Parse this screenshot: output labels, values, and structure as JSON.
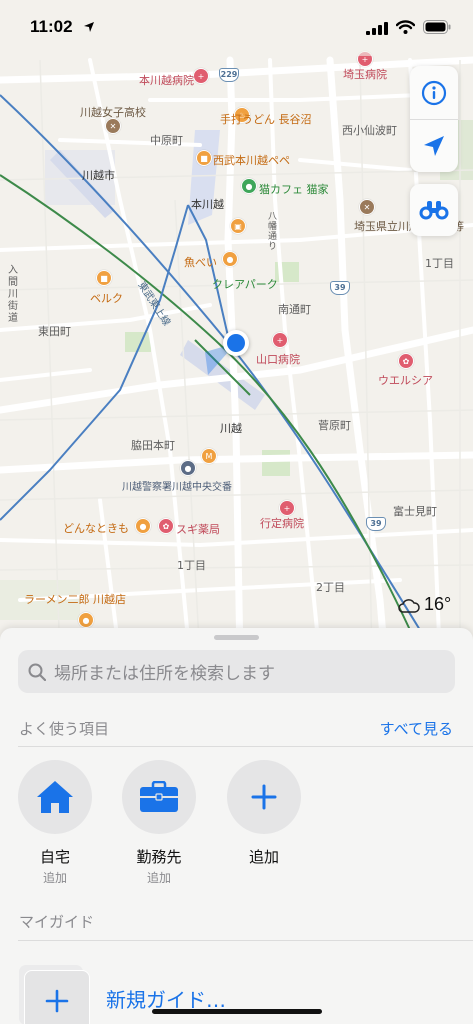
{
  "status_bar": {
    "time": "11:02"
  },
  "map": {
    "labels": {
      "kawagoe_hospital": "本川越病院",
      "saitama_hospital": "埼玉病院",
      "girls_hs": "川越女子高校",
      "udon": "手打うどん 長谷沼",
      "nishikosenba": "西小仙波町",
      "nakahara": "中原町",
      "pepe": "西武本川越ペペ",
      "kawagoe_city": "川越市",
      "cat_cafe": "猫カフェ 猫家",
      "honkawagoe": "本川越",
      "saitama_tech": "埼玉県立川越工業高等",
      "hachiman": "八幡通り",
      "uobei": "魚べい",
      "crea": "クレアパーク",
      "chome1": "1丁目",
      "iruma_kaido": "入間川街道",
      "belk": "ベルク",
      "tobu_tojo": "東武東上線",
      "minami": "南通町",
      "higashida": "東田町",
      "yamaguchi": "山口病院",
      "welcia": "ウエルシア",
      "kawagoe_station": "川越",
      "sugawara": "菅原町",
      "wakitahon": "脇田本町",
      "police": "川越警察署川越中央交番",
      "gyotei": "行定病院",
      "fujimi": "富士見町",
      "donnatokimo": "どんなときも",
      "sugi": "スギ薬局",
      "chome1b": "1丁目",
      "chome2": "2丁目",
      "ramen": "ラーメン二郎 川越店"
    },
    "shields": {
      "r229": "229",
      "r39a": "39",
      "r39b": "39"
    }
  },
  "controls": {
    "info_icon": "info-icon",
    "location_icon": "location-arrow-icon",
    "lookaround_icon": "binoculars-icon"
  },
  "weather": {
    "temp": "16°",
    "icon": "cloud-icon"
  },
  "sheet": {
    "search_placeholder": "場所または住所を検索します",
    "favorites_title": "よく使う項目",
    "see_all": "すべて見る",
    "favorites": [
      {
        "name": "自宅",
        "sub": "追加",
        "icon": "house-icon"
      },
      {
        "name": "勤務先",
        "sub": "追加",
        "icon": "briefcase-icon"
      },
      {
        "name": "追加",
        "icon": "plus-icon"
      }
    ],
    "guides_title": "マイガイド",
    "new_guide": "新規ガイド…"
  },
  "colors": {
    "accent": "#1a73e8",
    "route_blue": "#4a7fc1",
    "route_green": "#3d8a4a",
    "user_dot": "#1a73e8"
  }
}
